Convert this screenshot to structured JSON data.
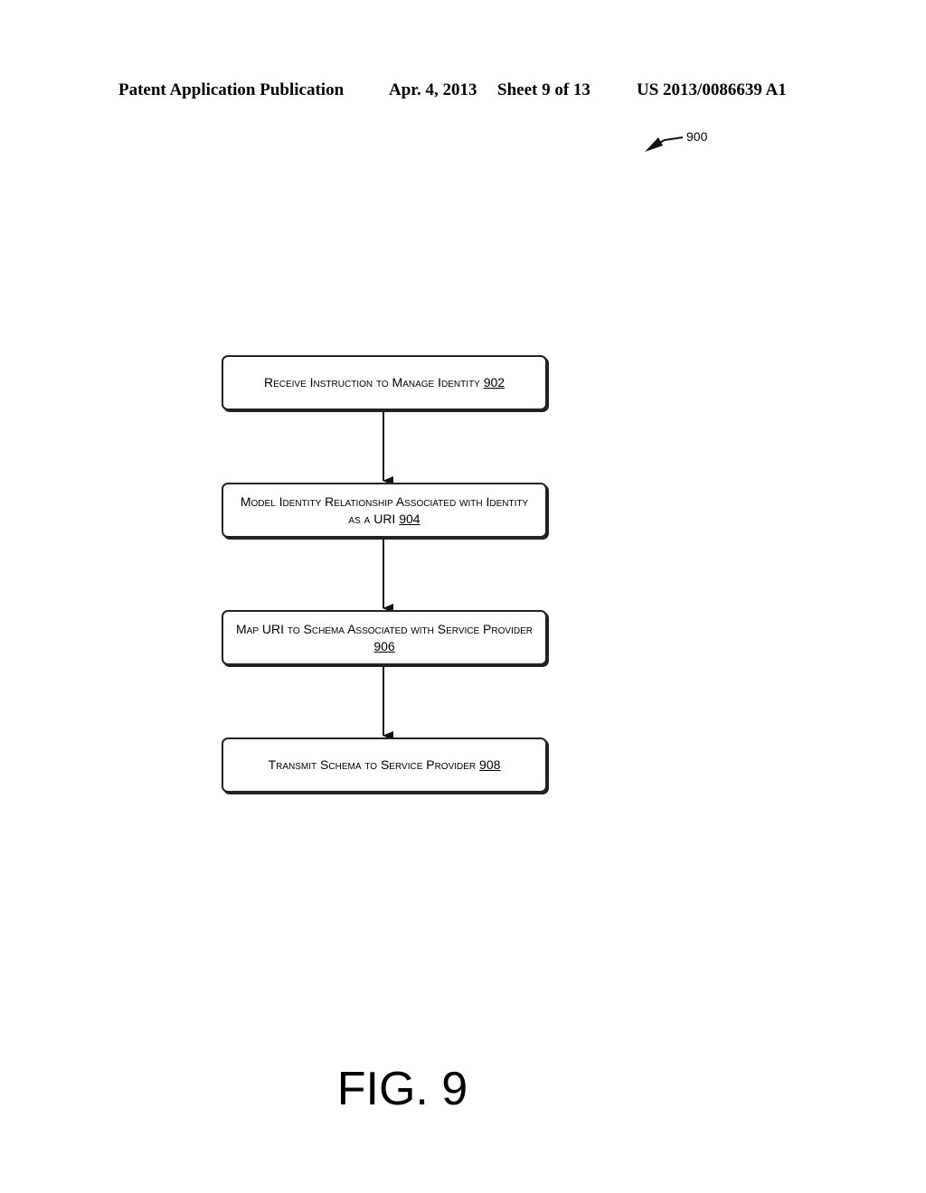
{
  "header": {
    "publication": "Patent Application Publication",
    "date": "Apr. 4, 2013",
    "sheet": "Sheet 9 of 13",
    "patent_number": "US 2013/0086639 A1"
  },
  "diagram": {
    "reference": "900",
    "steps": [
      {
        "text": "Receive Instruction to Manage Identity",
        "ref": "902"
      },
      {
        "text": "Model Identity Relationship Associated with Identity as a URI",
        "ref": "904"
      },
      {
        "text": "Map URI to Schema Associated with Service Provider",
        "ref": "906"
      },
      {
        "text": "Transmit Schema to Service Provider",
        "ref": "908"
      }
    ],
    "figure_label": "FIG. 9"
  }
}
